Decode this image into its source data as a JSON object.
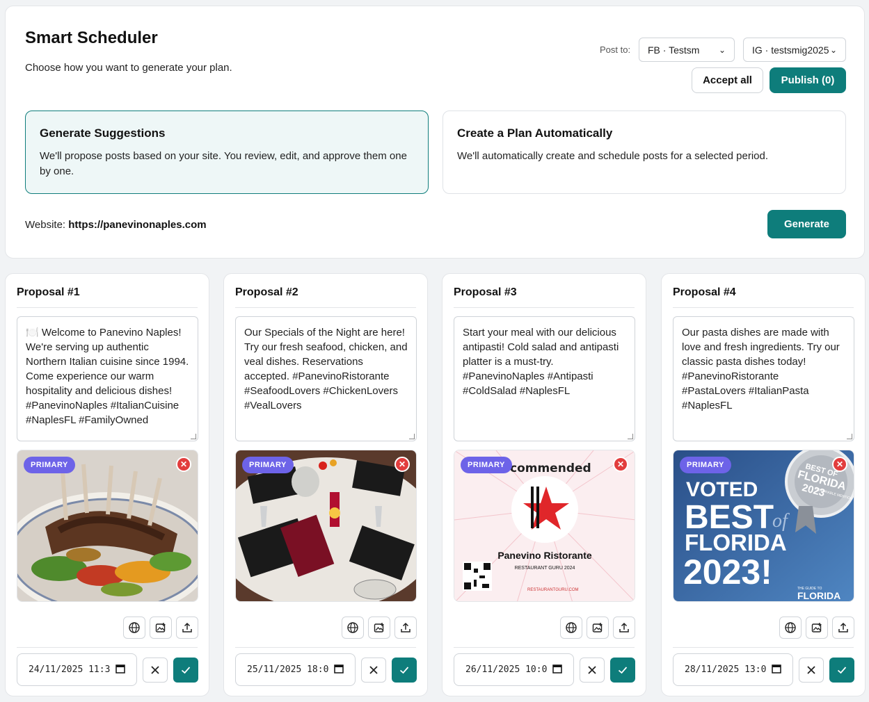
{
  "header": {
    "title": "Smart Scheduler",
    "subtitle": "Choose how you want to generate your plan.",
    "post_to_label": "Post to:",
    "fb_select": "FB · Testsm",
    "ig_select": "IG · testsmig2025",
    "accept_all": "Accept all",
    "publish": "Publish (0)"
  },
  "options": [
    {
      "title": "Generate Suggestions",
      "description": "We'll propose posts based on your site. You review, edit, and approve them one by one."
    },
    {
      "title": "Create a Plan Automatically",
      "description": "We'll automatically create and schedule posts for a selected period."
    }
  ],
  "website": {
    "label": "Website:",
    "url": "https://panevinonaples.com"
  },
  "generate_label": "Generate",
  "proposals": [
    {
      "title": "Proposal #1",
      "text": "🍽️ Welcome to Panevino Naples! We're serving up authentic Northern Italian cuisine since 1994. Come experience our warm hospitality and delicious dishes! #PanevinoNaples #ItalianCuisine #NaplesFL #FamilyOwned",
      "badge": "PRIMARY",
      "date": "24/11/2025  11:3"
    },
    {
      "title": "Proposal #2",
      "text": "Our Specials of the Night are here! Try our fresh seafood, chicken, and veal dishes. Reservations accepted. #PanevinoRistorante #SeafoodLovers #ChickenLovers #VealLovers",
      "badge": "PRIMARY",
      "date": "25/11/2025  18:0"
    },
    {
      "title": "Proposal #3",
      "text": "Start your meal with our delicious antipasti! Cold salad and antipasti platter is a must-try. #PanevinoNaples #Antipasti #ColdSalad #NaplesFL",
      "badge": "PRIMARY",
      "date": "26/11/2025  10:0",
      "img_text": {
        "top": "commended",
        "name": "Panevino Ristorante",
        "sub": "RESTAURANT GURU 2024",
        "footer": "RESTAURANTGURU.COM"
      }
    },
    {
      "title": "Proposal #4",
      "text": "Our pasta dishes are made with love and fresh ingredients. Try our classic pasta dishes today! #PanevinoRistorante #PastaLovers #ItalianPasta #NaplesFL",
      "badge": "PRIMARY",
      "date": "28/11/2025  13:0",
      "img_text": {
        "voted": "VOTED",
        "best": "BEST",
        "of": "of",
        "florida": "FLORIDA",
        "year": "2023!",
        "seal_top": "BEST OF",
        "seal_mid": "FLORIDA",
        "seal_year": "2023",
        "seal_sub": "HONORABLE MENTION",
        "footer_small": "THE GUIDE TO",
        "footer_big": "FLORIDA"
      }
    }
  ],
  "colors": {
    "accent": "#0e7d7b",
    "badge": "#6d63e8",
    "remove": "#e23d3d"
  }
}
